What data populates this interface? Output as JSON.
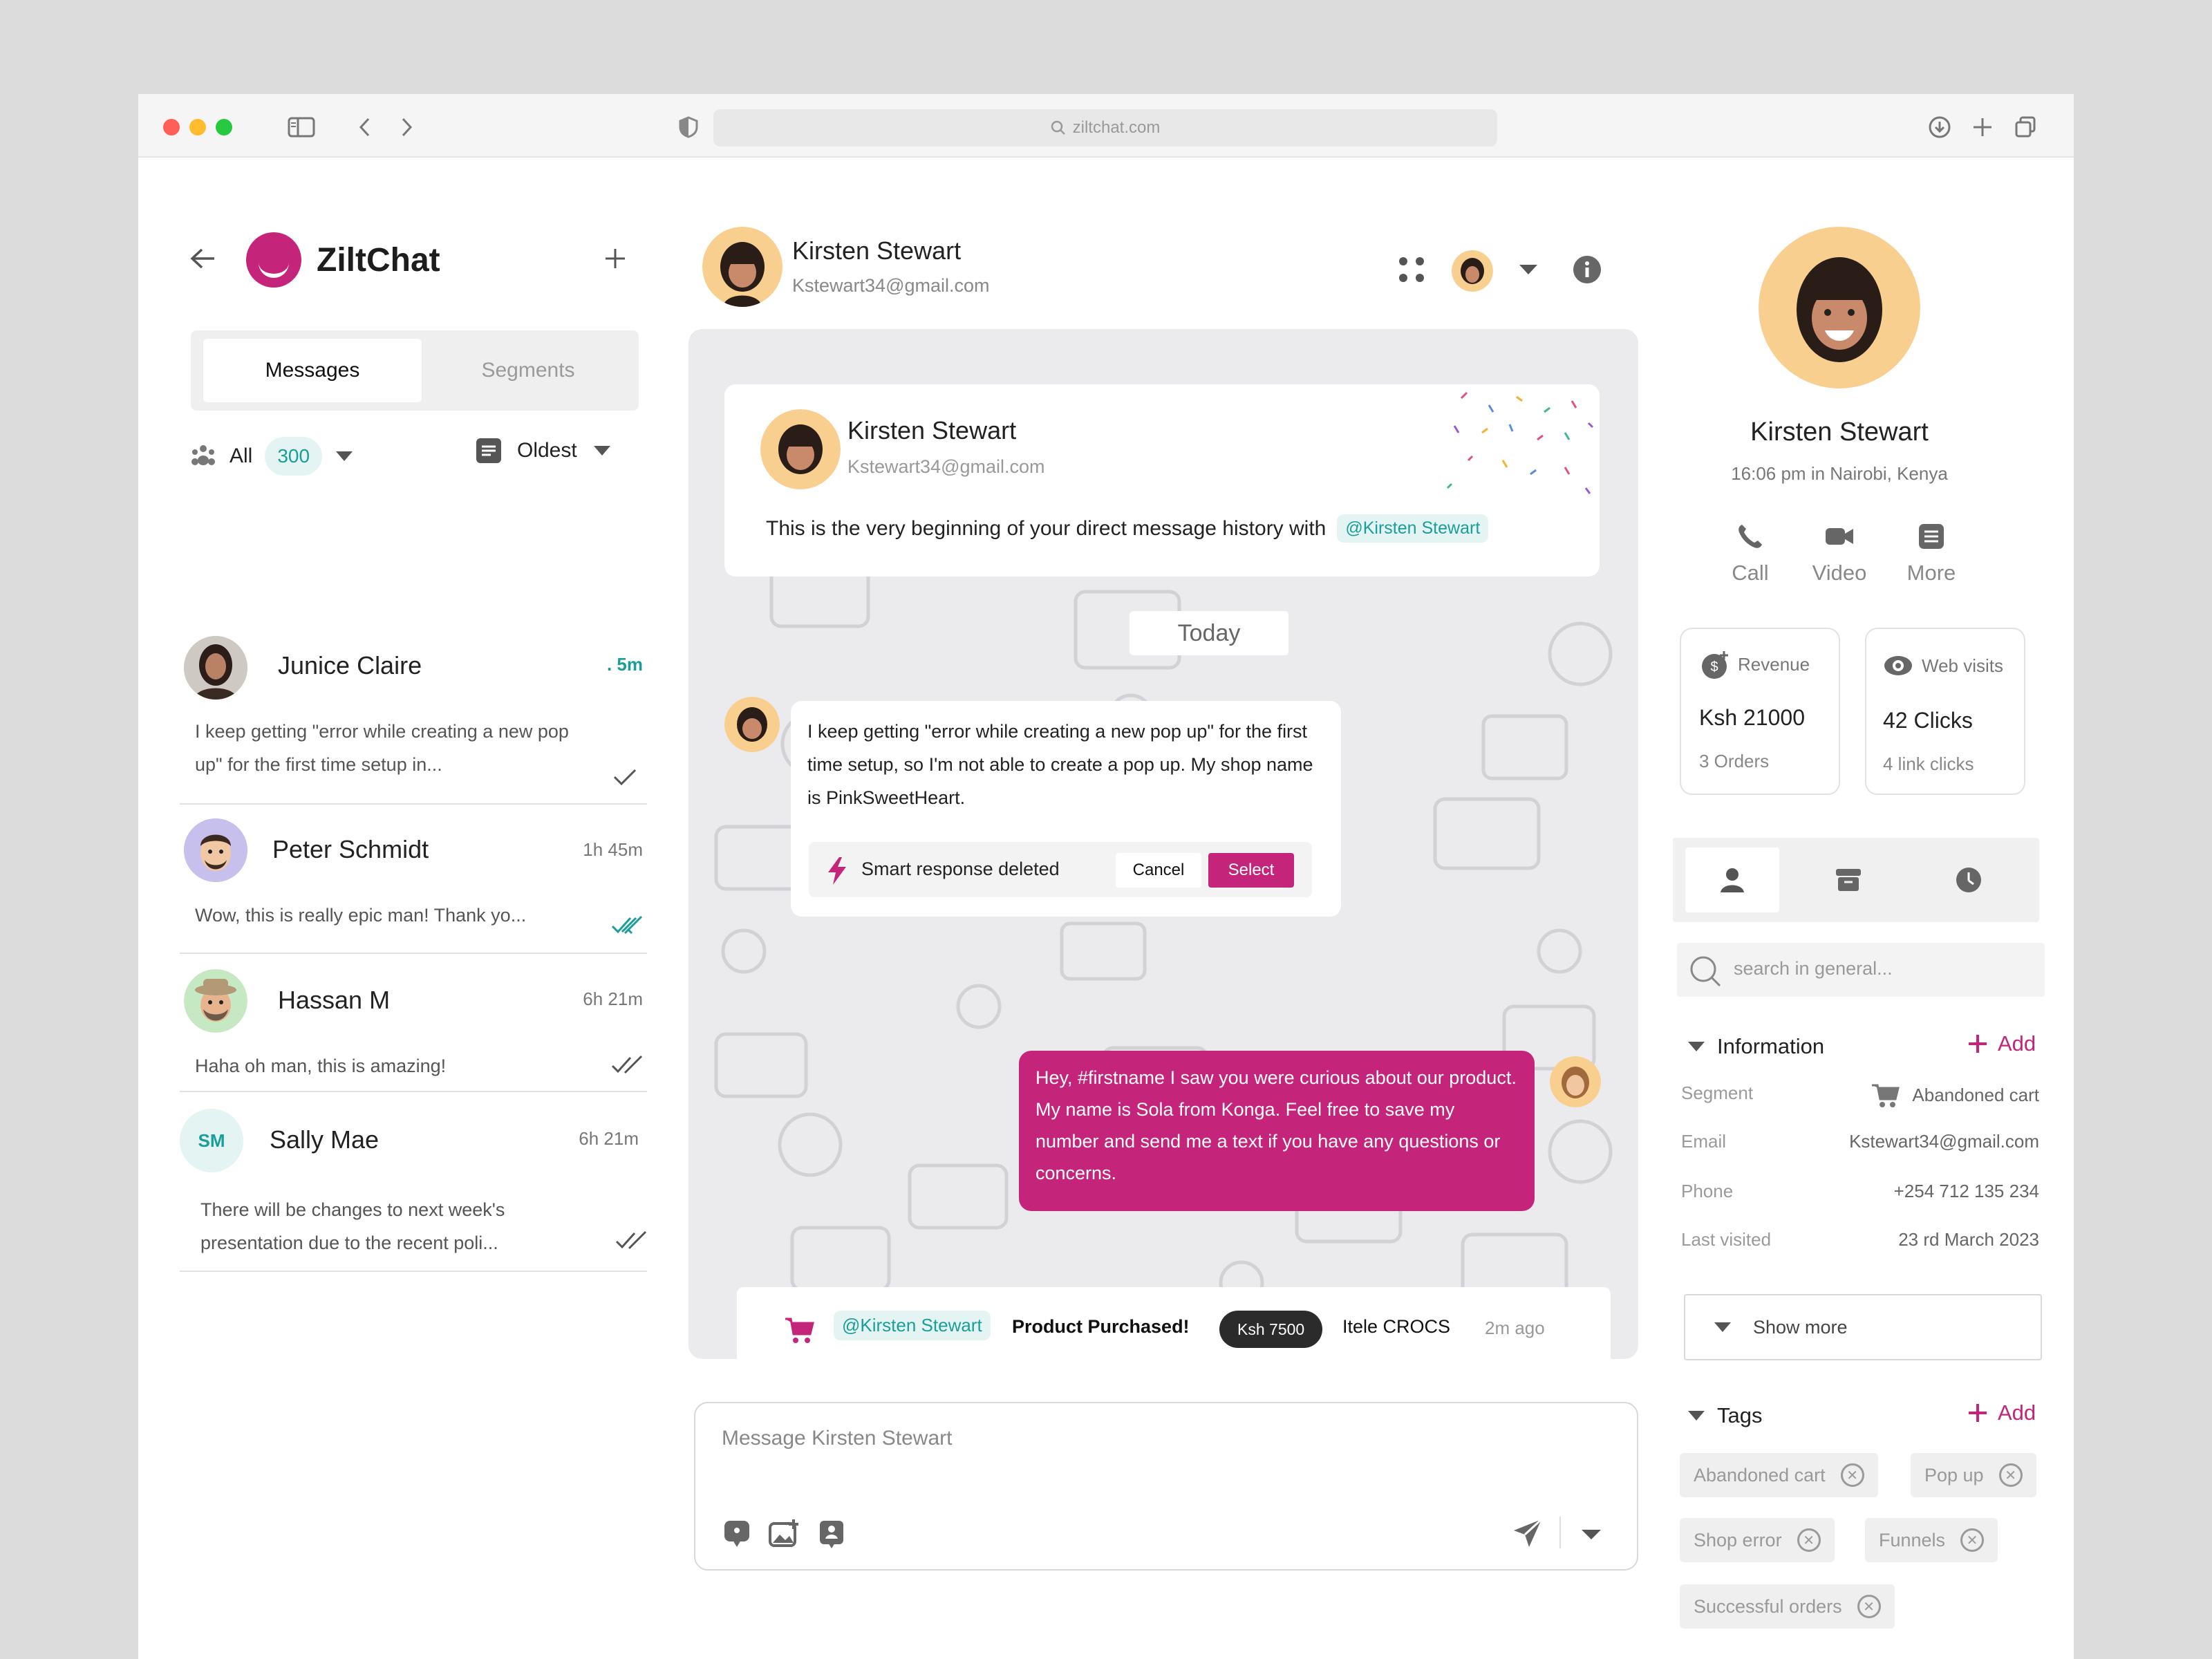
{
  "browser": {
    "url": "ziltchat.com"
  },
  "brand": {
    "name": "ZiltChat"
  },
  "tabs": {
    "messages": "Messages",
    "segments": "Segments"
  },
  "filters": {
    "all_label": "All",
    "all_count": "300",
    "sort_label": "Oldest"
  },
  "conversations": [
    {
      "initials": "",
      "name": "Junice Claire",
      "time": ". 5m",
      "preview": "I keep getting \"error while creating a new pop up\" for the first time setup in..."
    },
    {
      "initials": "",
      "name": "Peter Schmidt",
      "time": "1h 45m",
      "preview": "Wow, this is really epic man! Thank yo..."
    },
    {
      "initials": "",
      "name": "Hassan M",
      "time": "6h 21m",
      "preview": "Haha oh man, this is amazing!"
    },
    {
      "initials": "SM",
      "name": "Sally Mae",
      "time": "6h 21m",
      "preview": "There will be changes to next week's presentation due to the recent poli..."
    }
  ],
  "chat_header": {
    "name": "Kirsten Stewart",
    "email": "Kstewart34@gmail.com"
  },
  "intro_card": {
    "name": "Kirsten Stewart",
    "email": "Kstewart34@gmail.com",
    "text": "This is the very beginning of your direct message history with",
    "mention": "@Kirsten Stewart"
  },
  "day_separator": "Today",
  "incoming_message": {
    "text": "I keep getting \"error while creating a new pop up\" for the first time setup, so I'm not able to create a pop up. My shop name is PinkSweetHeart."
  },
  "smart_response": {
    "label": "Smart response deleted",
    "cancel": "Cancel",
    "select": "Select"
  },
  "outgoing_message": {
    "text": "Hey, #firstname I saw you were curious about our product. My name is Sola from Konga. Feel free to save my number and send me a text if you have any questions or concerns."
  },
  "purchase": {
    "mention": "@Kirsten Stewart",
    "label": "Product Purchased!",
    "amount": "Ksh 7500",
    "product": "Itele CROCS",
    "time": "2m ago"
  },
  "composer": {
    "placeholder": "Message Kirsten Stewart"
  },
  "profile": {
    "name": "Kirsten Stewart",
    "local_time": "16:06 pm in Nairobi, Kenya",
    "actions": [
      "Call",
      "Video",
      "More"
    ]
  },
  "stats": [
    {
      "title": "Revenue",
      "value": "Ksh 21000",
      "sub": "3 Orders"
    },
    {
      "title": "Web visits",
      "value": "42 Clicks",
      "sub": "4 link clicks"
    }
  ],
  "search": {
    "placeholder": "search in general..."
  },
  "information": {
    "title": "Information",
    "add": "Add",
    "rows": [
      {
        "label": "Segment",
        "value": "Abandoned cart"
      },
      {
        "label": "Email",
        "value": "Kstewart34@gmail.com"
      },
      {
        "label": "Phone",
        "value": "+254 712 135 234"
      },
      {
        "label": "Last visited",
        "value": "23 rd March 2023"
      }
    ],
    "show_more": "Show more"
  },
  "tags": {
    "title": "Tags",
    "add": "Add",
    "items": [
      "Abandoned cart",
      "Pop up",
      "Shop error",
      "Funnels",
      "Successful orders"
    ]
  },
  "colors": {
    "accent": "#c4257a",
    "teal": "#1a9e9a"
  }
}
